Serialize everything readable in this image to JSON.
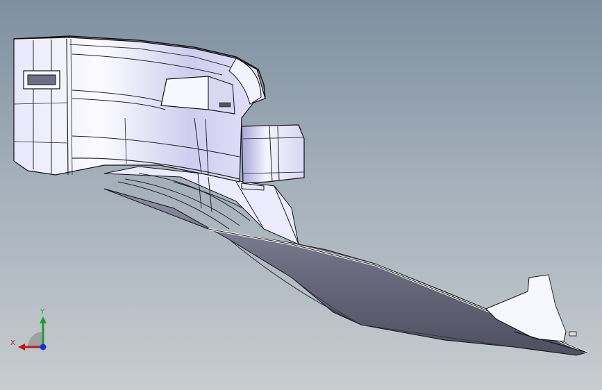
{
  "viewport": {
    "background_top": "#7e8f9f",
    "background_bottom": "#c7ccd0"
  },
  "model": {
    "face_color": "#f4f3ff",
    "shade_color": "#c4c2e6",
    "dark_color": "#5e5f70",
    "edge_color": "#111111"
  },
  "triad": {
    "x_label": "X",
    "y_label": "Y",
    "x_color": "#c0171b",
    "y_color": "#1f9a2e",
    "z_color": "#1a2fd0"
  }
}
